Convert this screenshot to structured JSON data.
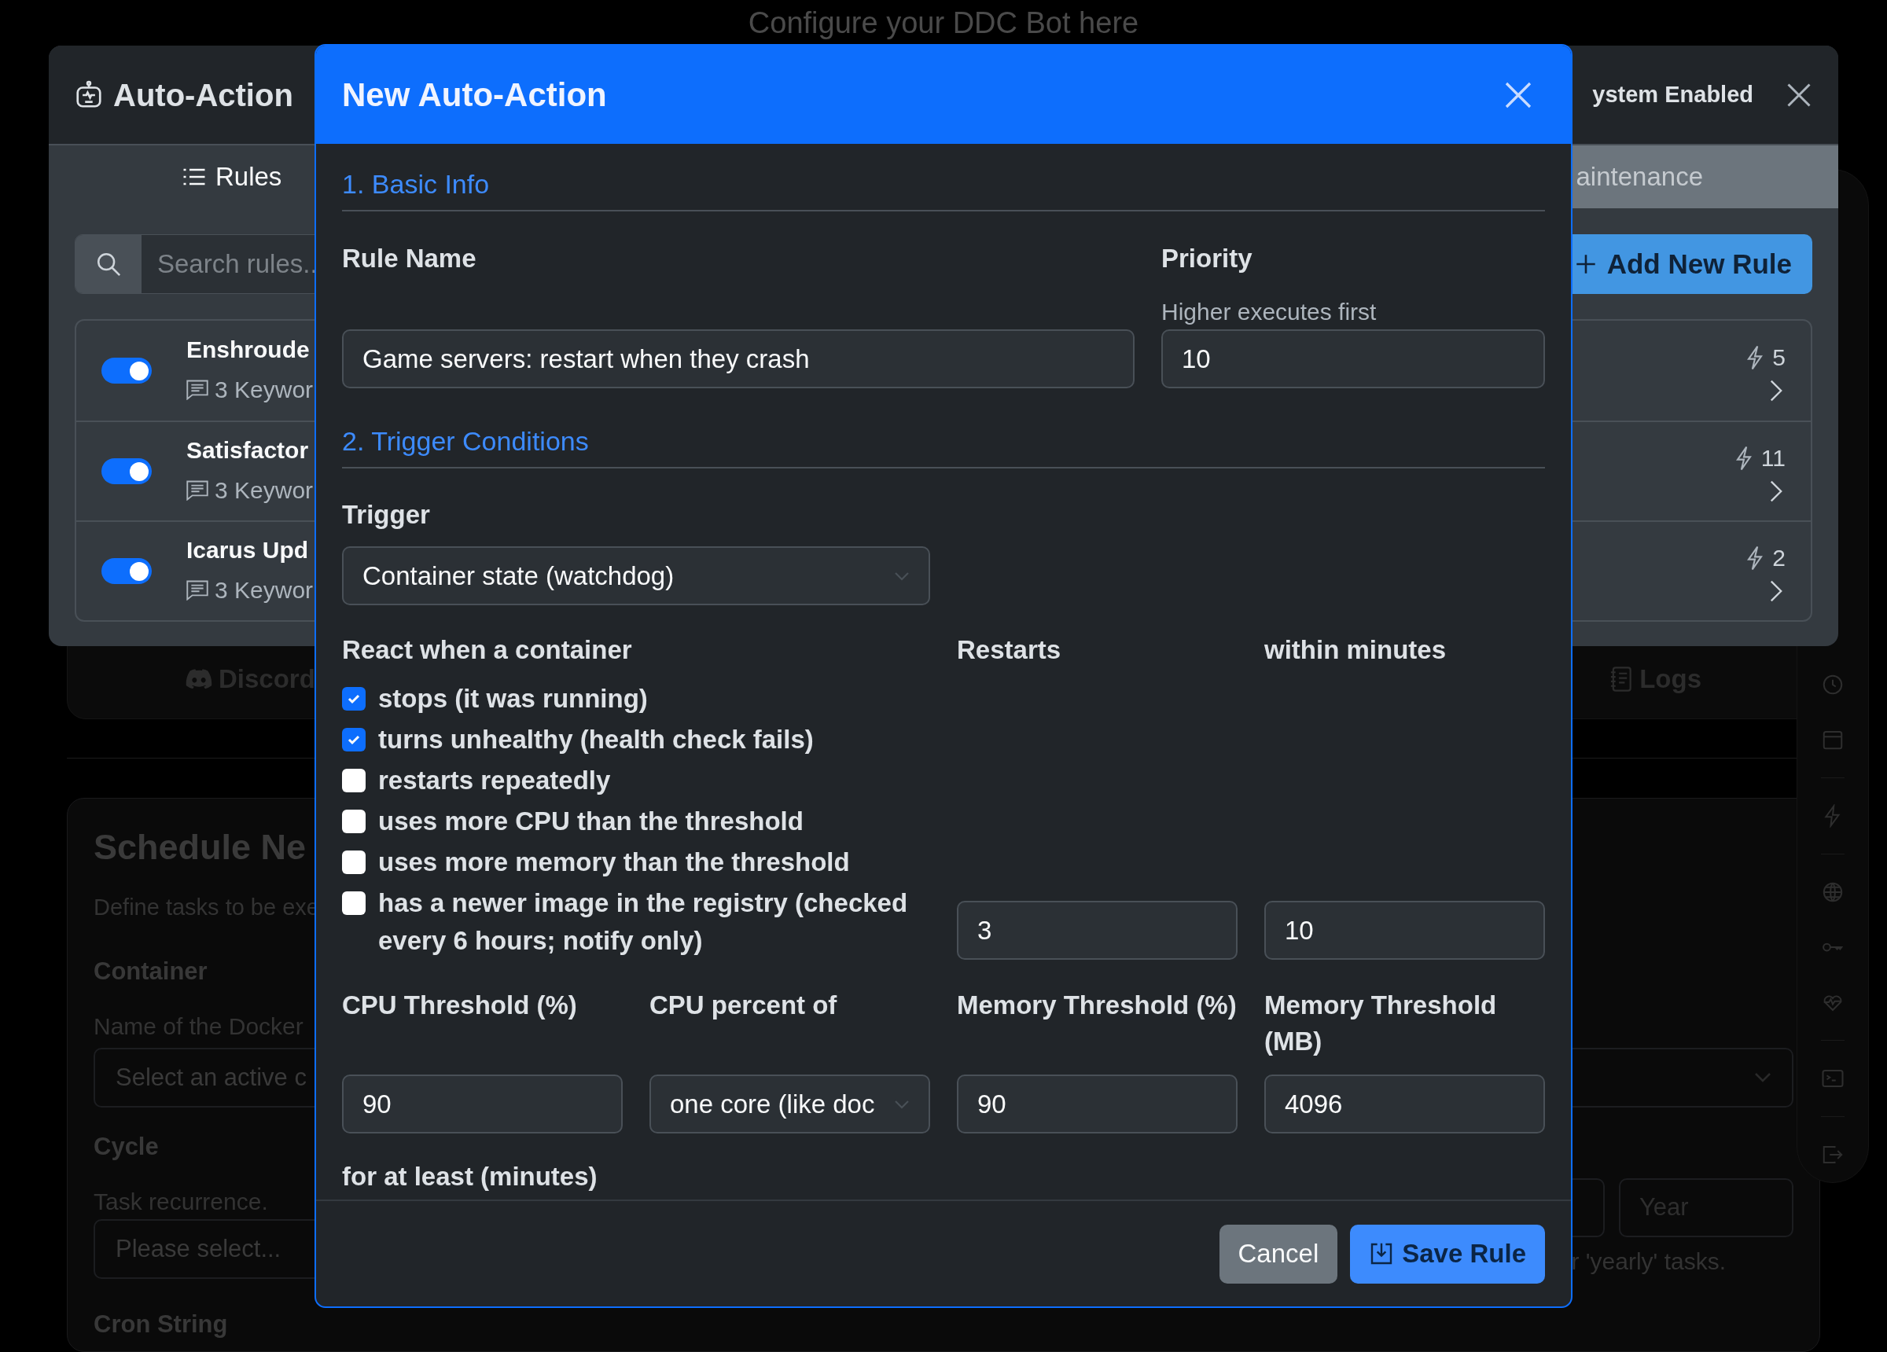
{
  "page": {
    "subtitle": "Configure your DDC Bot here",
    "tabs": [
      {
        "label": "Discord",
        "kind": "discord"
      },
      {
        "label": "Logs",
        "kind": "logs"
      }
    ],
    "schedule": {
      "title": "Schedule Ne",
      "description": "Define tasks to be exe",
      "container_label": "Container",
      "container_hint": "Name of the Docker",
      "container_select": "Select an active c",
      "cycle_label": "Cycle",
      "cycle_hint": "Task recurrence.",
      "cycle_select": "Please select...",
      "year_placeholder": "Year",
      "year_hint": "r 'yearly' tasks.",
      "cron_label": "Cron String"
    }
  },
  "panel": {
    "title": "Auto-Action",
    "system_label": "ystem Enabled",
    "tabs": [
      {
        "label": "Rules",
        "selected": true
      },
      {
        "label": "aintenance",
        "selected": false
      }
    ],
    "search": {
      "placeholder": "Search rules.."
    },
    "add_button": "Add New Rule",
    "rules": [
      {
        "name": "Enshroude",
        "keywords": "3 Keywor",
        "count": "5",
        "enabled": true
      },
      {
        "name": "Satisfactor",
        "keywords": "3 Keywor",
        "count": "11",
        "enabled": true
      },
      {
        "name": "Icarus Upd",
        "keywords": "3 Keywor",
        "count": "2",
        "enabled": true
      }
    ]
  },
  "modal": {
    "title": "New Auto-Action",
    "basic_heading": "1. Basic Info",
    "rule_name": {
      "label": "Rule Name",
      "value": "Game servers: restart when they crash"
    },
    "priority": {
      "label": "Priority",
      "hint": "Higher executes first",
      "value": "10"
    },
    "trigger_heading": "2. Trigger Conditions",
    "trigger": {
      "label": "Trigger",
      "value": "Container state (watchdog)"
    },
    "react_label": "React when a container",
    "conditions": [
      {
        "label": "stops (it was running)",
        "checked": true
      },
      {
        "label": "turns unhealthy (health check fails)",
        "checked": true
      },
      {
        "label": "restarts repeatedly",
        "checked": false
      },
      {
        "label": "uses more CPU than the threshold",
        "checked": false
      },
      {
        "label": "uses more memory than the threshold",
        "checked": false
      },
      {
        "label": "has a newer image in the registry (checked every 6 hours; notify only)",
        "checked": false
      }
    ],
    "restarts": {
      "label": "Restarts",
      "value": "3"
    },
    "within": {
      "label": "within minutes",
      "value": "10"
    },
    "thresholds": [
      {
        "label": "CPU Threshold (%)",
        "value": "90",
        "kind": "input"
      },
      {
        "label": "CPU percent of",
        "value": "one core (like doc",
        "kind": "select"
      },
      {
        "label": "Memory Threshold (%)",
        "value": "90",
        "kind": "input"
      },
      {
        "label": "Memory Threshold (MB)",
        "value": "4096",
        "kind": "input"
      }
    ],
    "duration_label": "for at least (minutes)",
    "buttons": [
      {
        "label": "Cancel",
        "kind": "secondary"
      },
      {
        "label": "Save Rule",
        "kind": "primary"
      }
    ]
  }
}
